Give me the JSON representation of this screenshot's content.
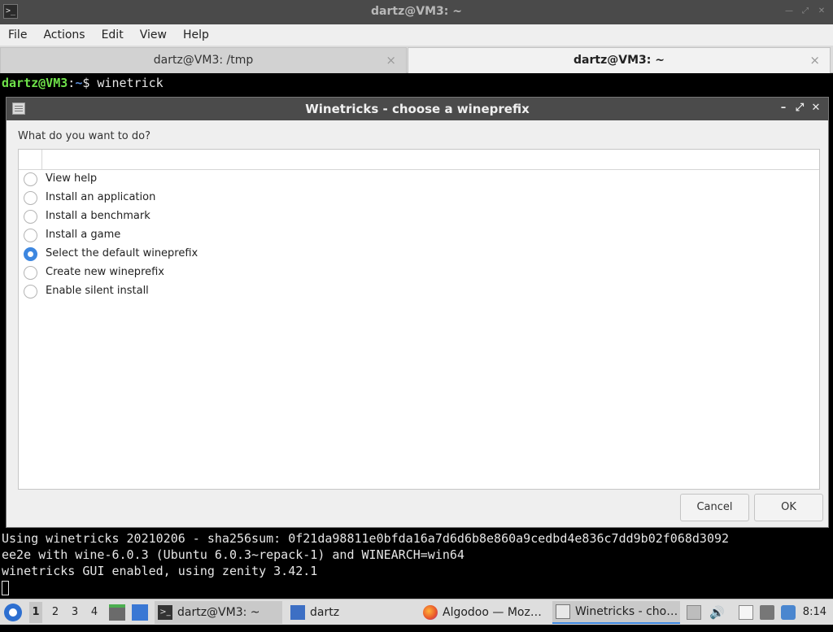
{
  "terminal_window": {
    "title": "dartz@VM3: ~",
    "menu": [
      "File",
      "Actions",
      "Edit",
      "View",
      "Help"
    ],
    "tabs": [
      {
        "label": "dartz@VM3: /tmp",
        "close": "×"
      },
      {
        "label": "dartz@VM3: ~",
        "close": "×"
      }
    ],
    "prompt_user": "dartz@VM3",
    "prompt_sep": ":",
    "prompt_path": "~",
    "prompt_symbol": "$ ",
    "command": "winetrick",
    "output_lines": [
      "Using winetricks 20210206 - sha256sum: 0f21da98811e0bfda16a7d6d6b8e860a9cedbd4e836c7dd9b02f068d3092",
      "ee2e with wine-6.0.3 (Ubuntu 6.0.3~repack-1) and WINEARCH=win64",
      "winetricks GUI enabled, using zenity 3.42.1"
    ]
  },
  "dialog": {
    "title": "Winetricks - choose a wineprefix",
    "question": "What do you want to do?",
    "options": [
      {
        "label": "View help",
        "checked": false
      },
      {
        "label": "Install an application",
        "checked": false
      },
      {
        "label": "Install a benchmark",
        "checked": false
      },
      {
        "label": "Install a game",
        "checked": false
      },
      {
        "label": "Select the default wineprefix",
        "checked": true
      },
      {
        "label": "Create new wineprefix",
        "checked": false
      },
      {
        "label": "Enable silent install",
        "checked": false
      }
    ],
    "cancel_label": "Cancel",
    "ok_label": "OK"
  },
  "taskbar": {
    "workspaces": [
      "1",
      "2",
      "3",
      "4"
    ],
    "tasks": [
      {
        "label": "dartz@VM3: ~",
        "icon": "terminal-icon"
      },
      {
        "label": "dartz",
        "icon": "folder-icon"
      },
      {
        "label": "Algodoo — Moz…",
        "icon": "firefox-icon"
      },
      {
        "label": "Winetricks - cho…",
        "icon": "window-icon"
      }
    ],
    "clock": "8:14"
  },
  "colors": {
    "accent": "#3d87e0",
    "prompt_user": "#6fe24a",
    "prompt_path": "#5b8dd8"
  }
}
